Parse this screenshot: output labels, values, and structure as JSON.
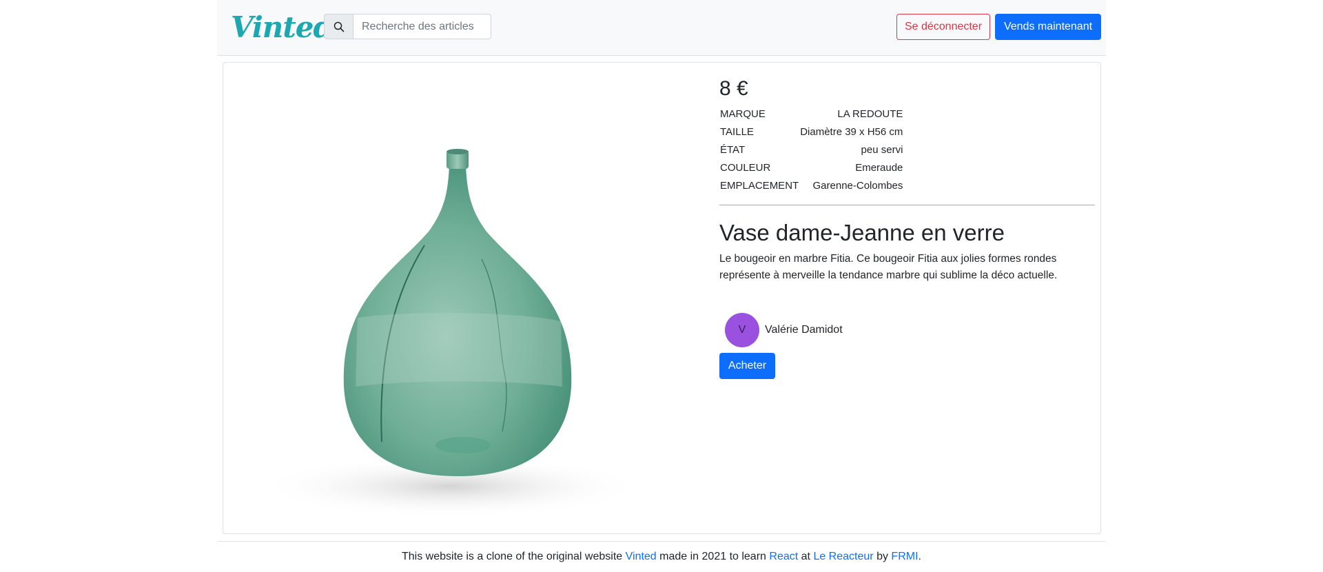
{
  "header": {
    "logo_text": "Vinted",
    "search_placeholder": "Recherche des articles",
    "logout_label": "Se déconnecter",
    "sell_label": "Vends maintenant"
  },
  "product": {
    "price": "8 €",
    "specs": [
      {
        "key": "MARQUE",
        "value": "LA REDOUTE"
      },
      {
        "key": "TAILLE",
        "value": "Diamètre 39 x H56 cm"
      },
      {
        "key": "ÉTAT",
        "value": "peu servi"
      },
      {
        "key": "COULEUR",
        "value": "Emeraude"
      },
      {
        "key": "EMPLACEMENT",
        "value": "Garenne-Colombes"
      }
    ],
    "title": "Vase dame-Jeanne en verre",
    "description": "Le bougeoir en marbre Fitia. Ce bougeoir Fitia aux jolies formes rondes représente à merveille la tendance marbre qui sublime la déco actuelle.",
    "seller": {
      "initial": "V",
      "name": "Valérie Damidot"
    },
    "buy_label": "Acheter"
  },
  "footer": {
    "text_1": "This website is a clone of the original website",
    "link_1": "Vinted",
    "text_2": "made in 2021 to learn",
    "link_2": "React",
    "text_3": "at",
    "link_3": "Le Reacteur",
    "text_4": "by",
    "link_4": "FRMI",
    "text_5": "."
  },
  "colors": {
    "brand": "#1ba8b1",
    "primary": "#0d6efd",
    "danger": "#dc3545",
    "avatar": "#9b51e0",
    "vase": "#5fa68e"
  },
  "icons": {
    "search": "search-icon"
  }
}
